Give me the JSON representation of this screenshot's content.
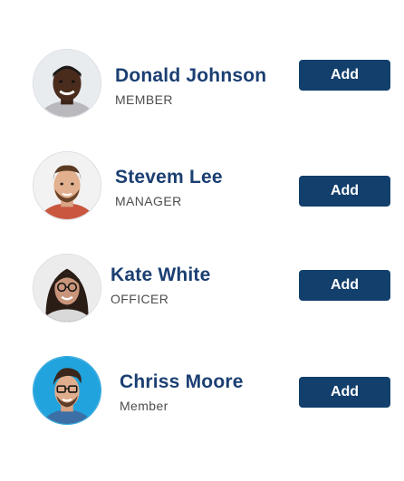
{
  "members": [
    {
      "name": "Donald Johnson",
      "role": "MEMBER",
      "button_label": "Add",
      "avatar_icon": "person-photo-icon"
    },
    {
      "name": "Stevem Lee",
      "role": "MANAGER",
      "button_label": "Add",
      "avatar_icon": "person-photo-icon"
    },
    {
      "name": "Kate White",
      "role": "OFFICER",
      "button_label": "Add",
      "avatar_icon": "person-photo-icon"
    },
    {
      "name": "Chriss Moore",
      "role": "Member",
      "button_label": "Add",
      "avatar_icon": "person-photo-icon"
    }
  ],
  "colors": {
    "name_text": "#1b3f72",
    "button_bg": "#123f6c",
    "button_text": "#ffffff",
    "role_text": "#4d4d4d"
  }
}
